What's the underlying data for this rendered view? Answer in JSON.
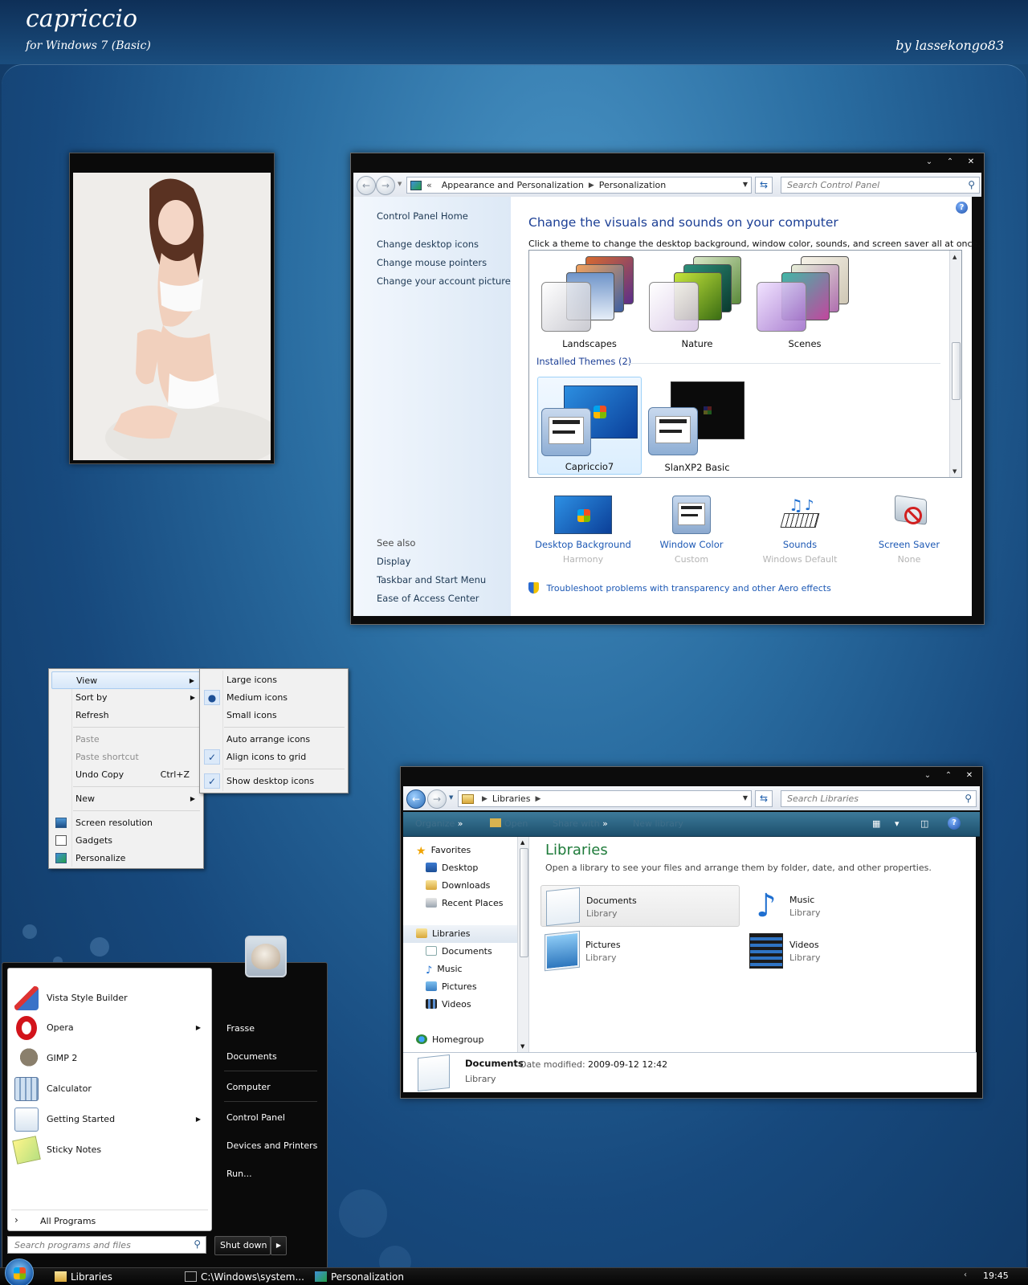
{
  "header": {
    "title": "capriccio",
    "subtitle": "for Windows 7 (Basic)",
    "author": "by lassekongo83"
  },
  "control_panel": {
    "breadcrumb": [
      "Appearance and Personalization",
      "Personalization"
    ],
    "search_placeholder": "Search Control Panel",
    "sidebar": {
      "home": "Control Panel Home",
      "links": [
        "Change desktop icons",
        "Change mouse pointers",
        "Change your account picture"
      ],
      "see_also_title": "See also",
      "see_also": [
        "Display",
        "Taskbar and Start Menu",
        "Ease of Access Center"
      ]
    },
    "heading": "Change the visuals and sounds on your computer",
    "description": "Click a theme to change the desktop background, window color, sounds, and screen saver all at once.",
    "themes": [
      "Landscapes",
      "Nature",
      "Scenes"
    ],
    "installed_group": "Installed Themes (2)",
    "installed": [
      "Capriccio7",
      "SlanXP2 Basic"
    ],
    "options": [
      {
        "name": "Desktop Background",
        "value": "Harmony"
      },
      {
        "name": "Window Color",
        "value": "Custom"
      },
      {
        "name": "Sounds",
        "value": "Windows Default"
      },
      {
        "name": "Screen Saver",
        "value": "None"
      }
    ],
    "troubleshoot": "Troubleshoot problems with transparency and other Aero effects"
  },
  "context_menu": {
    "items": [
      "View",
      "Sort by",
      "Refresh",
      "Paste",
      "Paste shortcut",
      "Undo Copy",
      "New",
      "Screen resolution",
      "Gadgets",
      "Personalize"
    ],
    "undo_accel": "Ctrl+Z",
    "submenu": [
      "Large icons",
      "Medium icons",
      "Small icons",
      "Auto arrange icons",
      "Align icons to grid",
      "Show desktop icons"
    ]
  },
  "explorer": {
    "breadcrumb": "Libraries",
    "search_placeholder": "Search Libraries",
    "commands": [
      "Organize",
      "Open",
      "Share with",
      "New library"
    ],
    "nav": {
      "favorites": "Favorites",
      "favorites_items": [
        "Desktop",
        "Downloads",
        "Recent Places"
      ],
      "libraries": "Libraries",
      "libraries_items": [
        "Documents",
        "Music",
        "Pictures",
        "Videos"
      ],
      "homegroup": "Homegroup"
    },
    "title": "Libraries",
    "description": "Open a library to see your files and arrange them by folder, date, and other properties.",
    "library_type": "Library",
    "libraries": [
      "Documents",
      "Music",
      "Pictures",
      "Videos"
    ],
    "details": {
      "name": "Documents",
      "type": "Library",
      "modified_label": "Date modified:",
      "modified_value": "2009-09-12 12:42"
    }
  },
  "start_menu": {
    "programs": [
      "Vista Style Builder",
      "Opera",
      "GIMP 2",
      "Calculator",
      "Getting Started",
      "Sticky Notes"
    ],
    "all_programs": "All Programs",
    "search_placeholder": "Search programs and files",
    "right": [
      "Frasse",
      "Documents",
      "Computer",
      "Control Panel",
      "Devices and Printers",
      "Run..."
    ],
    "shutdown": "Shut down"
  },
  "taskbar": {
    "buttons": [
      "Libraries",
      "C:\\Windows\\system...",
      "Personalization"
    ],
    "clock": "19:45"
  }
}
